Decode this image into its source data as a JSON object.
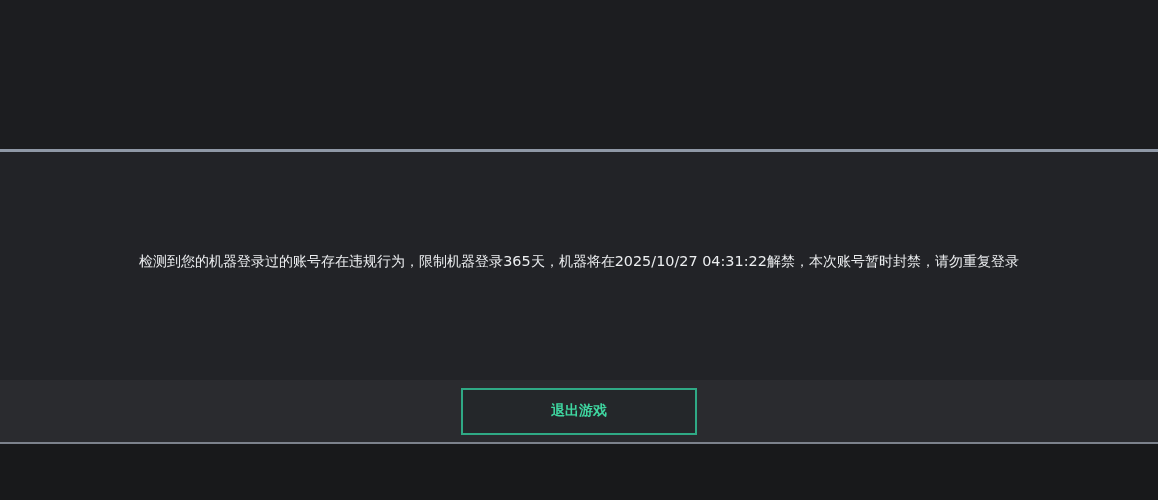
{
  "dialog": {
    "message": "检测到您的机器登录过的账号存在违规行为，限制机器登录365天，机器将在2025/10/27 04:31:22解禁，本次账号暂时封禁，请勿重复登录"
  },
  "buttons": [
    {
      "label": "退出游戏"
    }
  ]
}
